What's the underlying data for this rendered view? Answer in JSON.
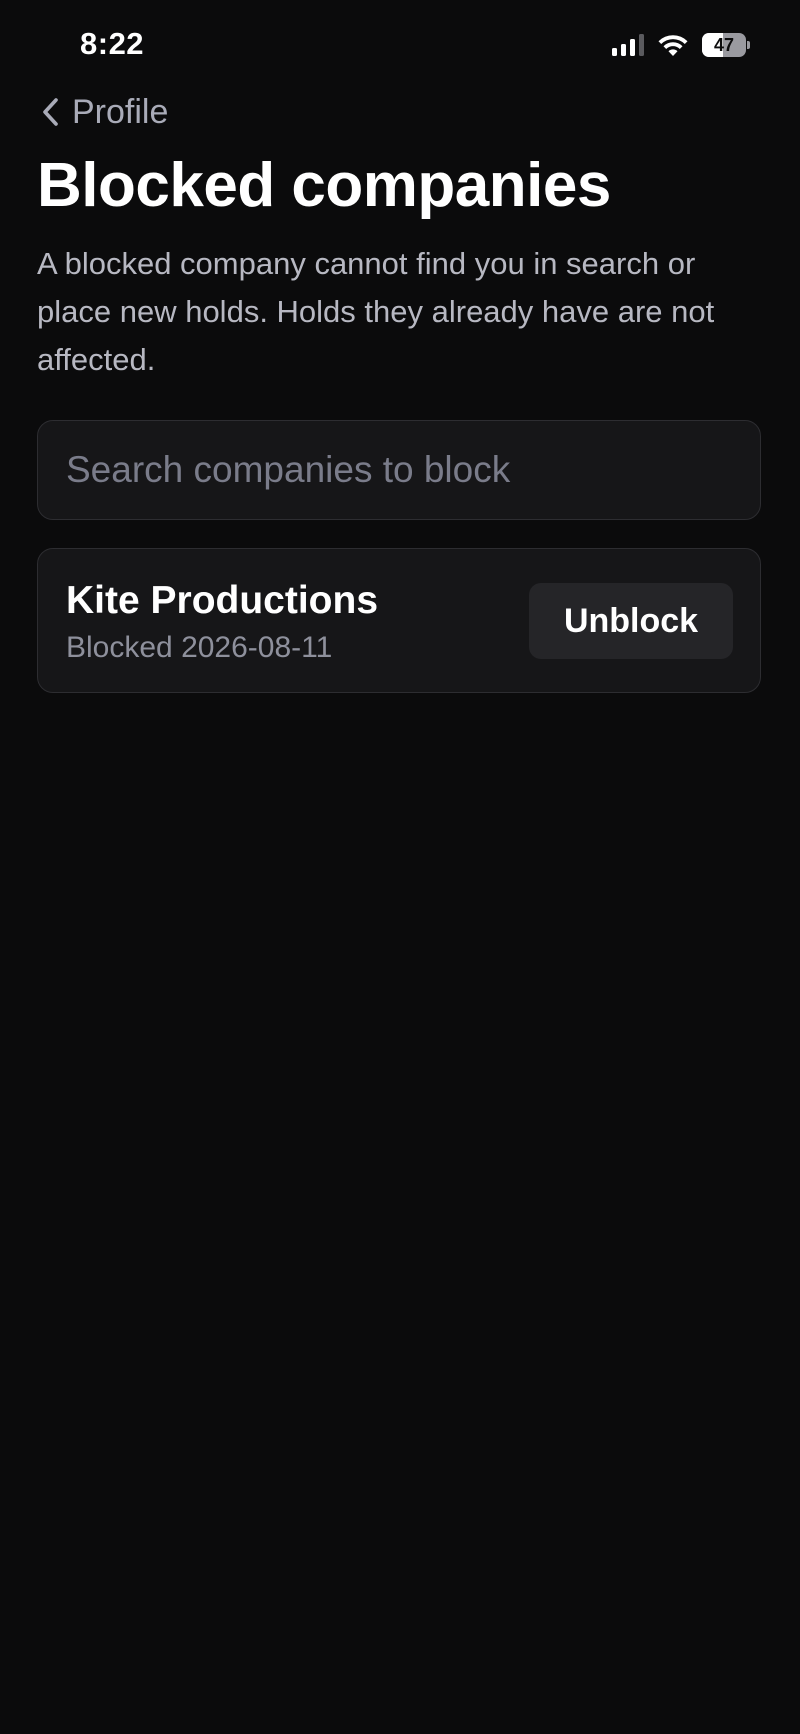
{
  "status_bar": {
    "time": "8:22",
    "battery_level": "47",
    "battery_fraction": 0.47
  },
  "nav": {
    "back_label": "Profile"
  },
  "header": {
    "title": "Blocked companies",
    "description": "A blocked company cannot find you in search or place new holds. Holds they already have are not affected."
  },
  "search": {
    "value": "",
    "placeholder": "Search companies to block"
  },
  "blocked_list": [
    {
      "name": "Kite Productions",
      "blocked_on": "Blocked 2026-08-11",
      "action_label": "Unblock"
    }
  ],
  "colors": {
    "background": "#0b0b0c",
    "card": "#161618",
    "muted_text": "#b7b8c2",
    "back_link": "#a9abb8"
  }
}
